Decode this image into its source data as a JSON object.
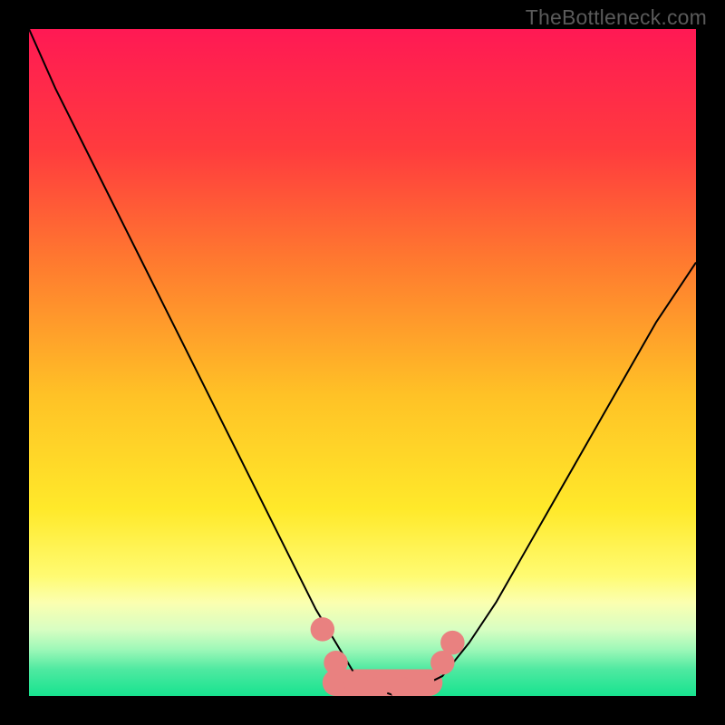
{
  "watermark": {
    "text": "TheBottleneck.com"
  },
  "chart_data": {
    "type": "line",
    "title": "",
    "subtitle": "",
    "xlabel": "",
    "ylabel": "",
    "xlim": [
      0,
      100
    ],
    "ylim": [
      0,
      100
    ],
    "grid": false,
    "legend": null,
    "annotations": [],
    "background_gradient_stops": [
      {
        "pos": 0.0,
        "color": "#ff1954"
      },
      {
        "pos": 0.18,
        "color": "#ff3b3e"
      },
      {
        "pos": 0.35,
        "color": "#ff7a2f"
      },
      {
        "pos": 0.55,
        "color": "#ffc226"
      },
      {
        "pos": 0.72,
        "color": "#ffe92a"
      },
      {
        "pos": 0.82,
        "color": "#fffb72"
      },
      {
        "pos": 0.86,
        "color": "#fbffb0"
      },
      {
        "pos": 0.9,
        "color": "#d8fec2"
      },
      {
        "pos": 0.93,
        "color": "#9ef8b8"
      },
      {
        "pos": 0.96,
        "color": "#4fe9a1"
      },
      {
        "pos": 1.0,
        "color": "#17e38f"
      }
    ],
    "series": [
      {
        "name": "bottleneck-curve",
        "color": "#000000",
        "stroke_width": 2,
        "x": [
          0,
          4,
          8,
          12,
          16,
          20,
          24,
          28,
          32,
          36,
          40,
          43,
          46,
          49,
          52,
          55,
          58,
          62,
          66,
          70,
          74,
          78,
          82,
          86,
          90,
          94,
          98,
          100
        ],
        "y": [
          100,
          91,
          83,
          75,
          67,
          59,
          51,
          43,
          35,
          27,
          19,
          13,
          8,
          3,
          1,
          0,
          1,
          3,
          8,
          14,
          21,
          28,
          35,
          42,
          49,
          56,
          62,
          65
        ]
      }
    ],
    "optimal_band": {
      "name": "optimal-band",
      "color": "#e98180",
      "x_start": 44,
      "x_end": 62,
      "y": 2,
      "thickness": 4
    },
    "optimal_markers": {
      "name": "optimal-markers",
      "color": "#e98180",
      "radius": 1.8,
      "points": [
        {
          "x": 44,
          "y": 10
        },
        {
          "x": 46,
          "y": 5
        },
        {
          "x": 49,
          "y": 2
        },
        {
          "x": 52,
          "y": 1
        },
        {
          "x": 56,
          "y": 1
        },
        {
          "x": 59,
          "y": 2
        },
        {
          "x": 62,
          "y": 5
        },
        {
          "x": 63.5,
          "y": 8
        }
      ]
    }
  }
}
